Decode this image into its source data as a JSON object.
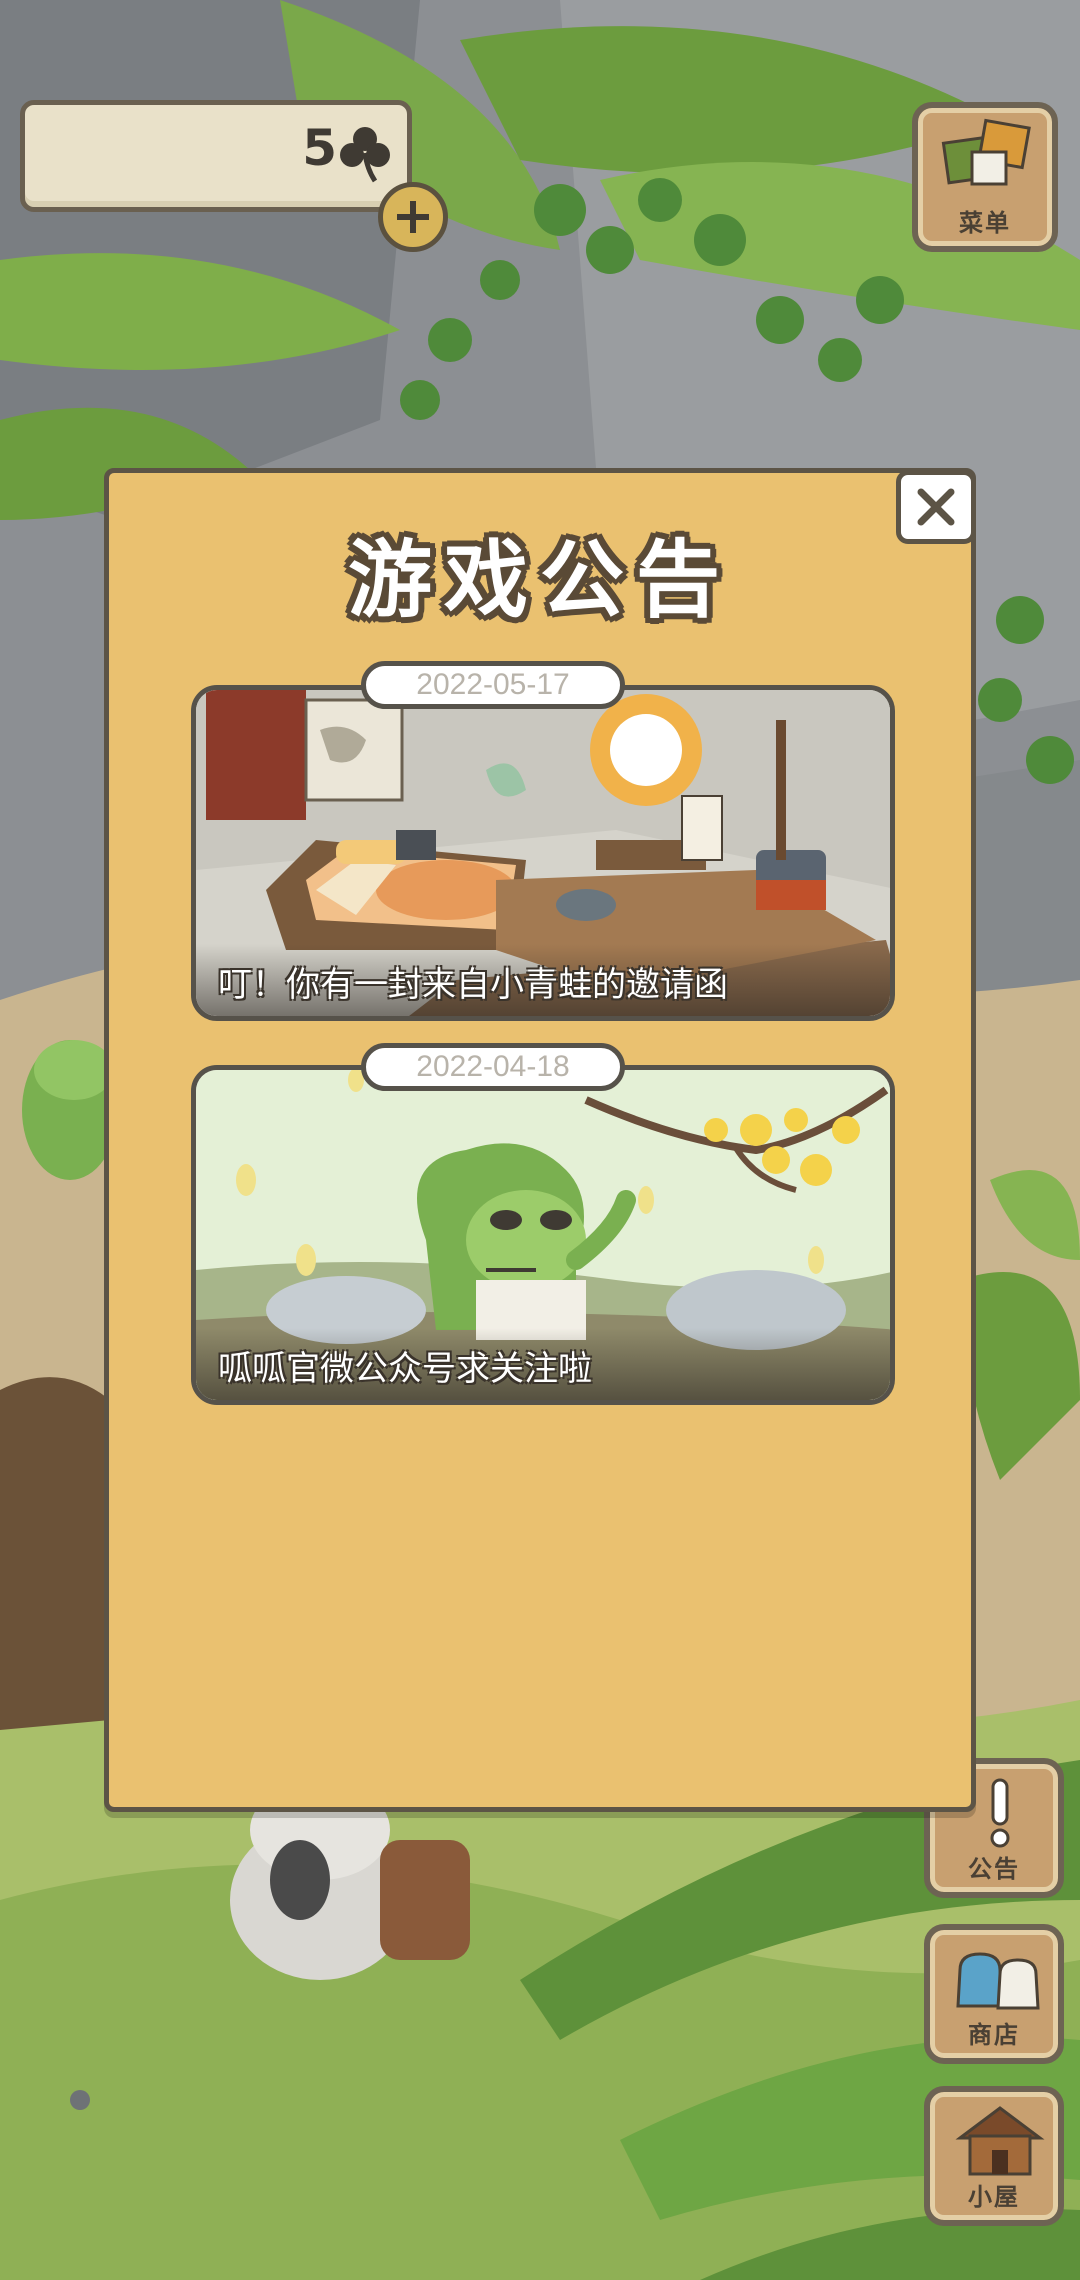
{
  "hud": {
    "clover_count": "5",
    "clover_icon": "clover-icon",
    "plus_icon": "plus-icon"
  },
  "side_menu": {
    "menu_label": "菜单",
    "notice_label": "公告",
    "shop_label": "商店",
    "house_label": "小屋"
  },
  "modal": {
    "title": "游戏公告",
    "close_icon": "close-icon",
    "announcements": [
      {
        "date": "2022-05-17",
        "caption": "叮！你有一封来自小青蛙的邀请函"
      },
      {
        "date": "2022-04-18",
        "caption": "呱呱官微公众号求关注啦"
      }
    ]
  },
  "colors": {
    "modal_bg": "#eac170",
    "border": "#5c5446",
    "button_wood": "#c8a070"
  }
}
